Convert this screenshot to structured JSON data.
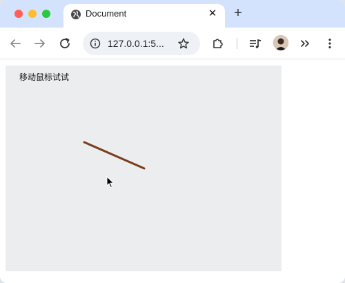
{
  "browser": {
    "tab": {
      "title": "Document"
    },
    "address_bar": {
      "url": "127.0.0.1:5..."
    }
  },
  "page": {
    "heading": "移动鼠标试试"
  },
  "colors": {
    "tabstrip": "#d3e3fd",
    "canvas_background": "#ebedee",
    "stroke": "#7a3d1e"
  }
}
